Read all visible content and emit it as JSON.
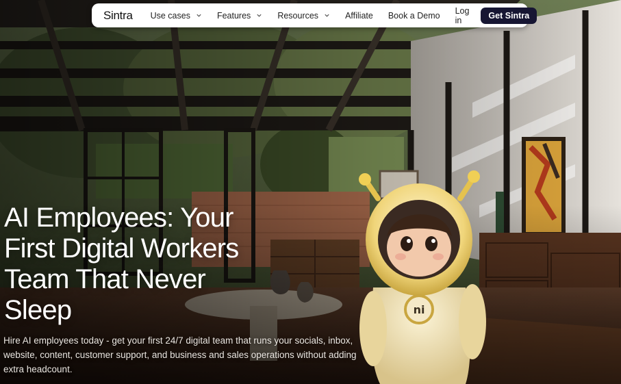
{
  "nav": {
    "logo": "Sintra",
    "items": [
      {
        "label": "Use cases",
        "has_dropdown": true
      },
      {
        "label": "Features",
        "has_dropdown": true
      },
      {
        "label": "Resources",
        "has_dropdown": true
      },
      {
        "label": "Affiliate",
        "has_dropdown": false
      },
      {
        "label": "Book a Demo",
        "has_dropdown": false
      }
    ],
    "login": "Log in",
    "cta": "Get Sintra"
  },
  "hero": {
    "title": "AI Employees: Your First Digital Workers Team That Never Sleep",
    "subtitle": "Hire AI employees today - get your first 24/7 digital team that runs your socials, inbox, website, content, customer support, and business and sales operations without adding extra headcount.",
    "mascot_badge": "ni"
  },
  "colors": {
    "cta_background": "#171633",
    "nav_background": "#ffffff",
    "title_text": "#ffffff"
  }
}
